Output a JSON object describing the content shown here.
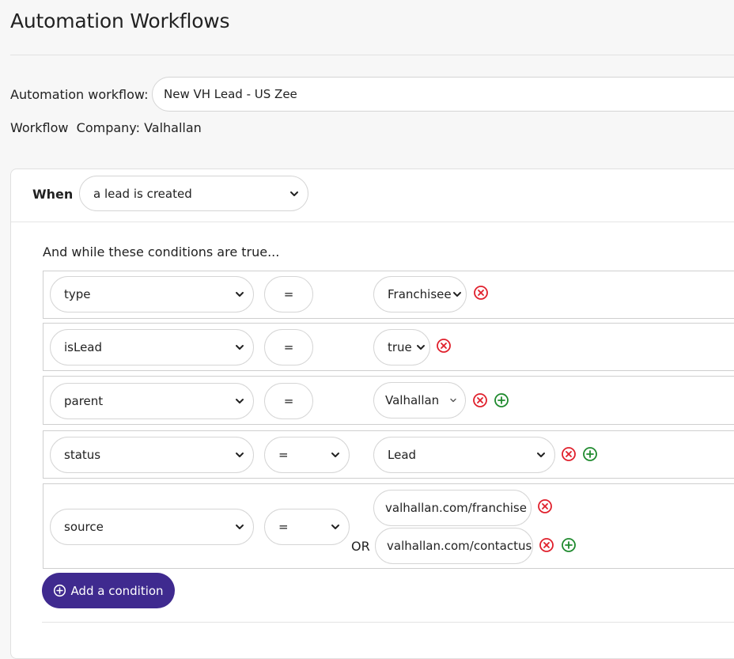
{
  "page": {
    "title": "Automation Workflows"
  },
  "workflow": {
    "name_label": "Automation workflow:",
    "name_value": "New VH Lead - US Zee",
    "company_label": "Workflow  Company:",
    "company_value": "Valhallan"
  },
  "trigger": {
    "label": "When",
    "value": "a lead is created"
  },
  "conditions": {
    "title": "And while these conditions are true...",
    "rows": [
      {
        "field": "type",
        "operator": "=",
        "values": [
          "Franchisee"
        ]
      },
      {
        "field": "isLead",
        "operator": "=",
        "values": [
          "true"
        ]
      },
      {
        "field": "parent",
        "operator": "=",
        "values": [
          "Valhallan"
        ]
      },
      {
        "field": "status",
        "operator": "=",
        "values": [
          "Lead"
        ]
      },
      {
        "field": "source",
        "operator": "=",
        "values": [
          "valhallan.com/franchise",
          "valhallan.com/contactus"
        ],
        "joiner": "OR"
      }
    ],
    "add_label": "Add a condition"
  },
  "colors": {
    "accent": "#3f2a8f",
    "remove": "#e0202c",
    "add": "#1f8a2e"
  },
  "icons": {
    "remove": "circle-x-icon",
    "add": "circle-plus-icon",
    "dropdown": "chevron-down-icon"
  }
}
